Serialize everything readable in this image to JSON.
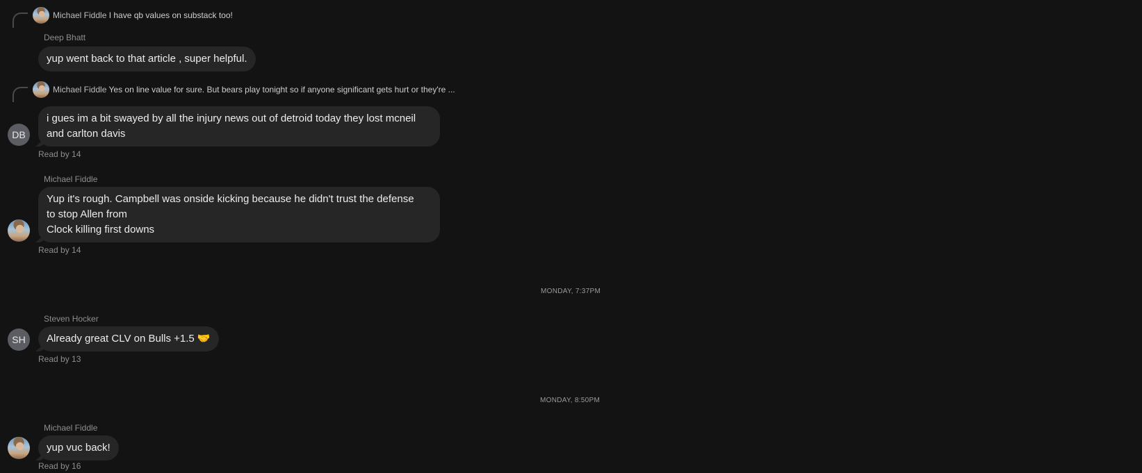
{
  "replies": [
    {
      "name": "Michael Fiddle",
      "text": "I have qb values on substack too!"
    },
    {
      "name": "Michael Fiddle",
      "text": "Yes on line value for sure. But bears play tonight so if anyone significant gets hurt or they're ..."
    }
  ],
  "messages": [
    {
      "sender": "Deep Bhatt",
      "text": "yup went back to that article , super helpful."
    },
    {
      "initials": "DB",
      "text_lines": [
        "i gues im a bit swayed by all the injury news out of detroid today they lost mcneil",
        "and carlton davis"
      ],
      "read_by": "Read by 14"
    },
    {
      "sender": "Michael Fiddle",
      "text_lines": [
        "Yup it's rough. Campbell was onside kicking because he didn't trust the defense",
        "to stop Allen from",
        "Clock killing first downs"
      ],
      "read_by": "Read by 14"
    },
    {
      "sender": "Steven Hocker",
      "initials": "SH",
      "text": "Already great CLV on Bulls +1.5 🤝",
      "read_by": "Read by 13"
    },
    {
      "sender": "Michael Fiddle",
      "text": "yup vuc back!",
      "read_by": "Read by 16"
    }
  ],
  "timestamps": [
    "MONDAY, 7:37PM",
    "MONDAY, 8:50PM"
  ]
}
